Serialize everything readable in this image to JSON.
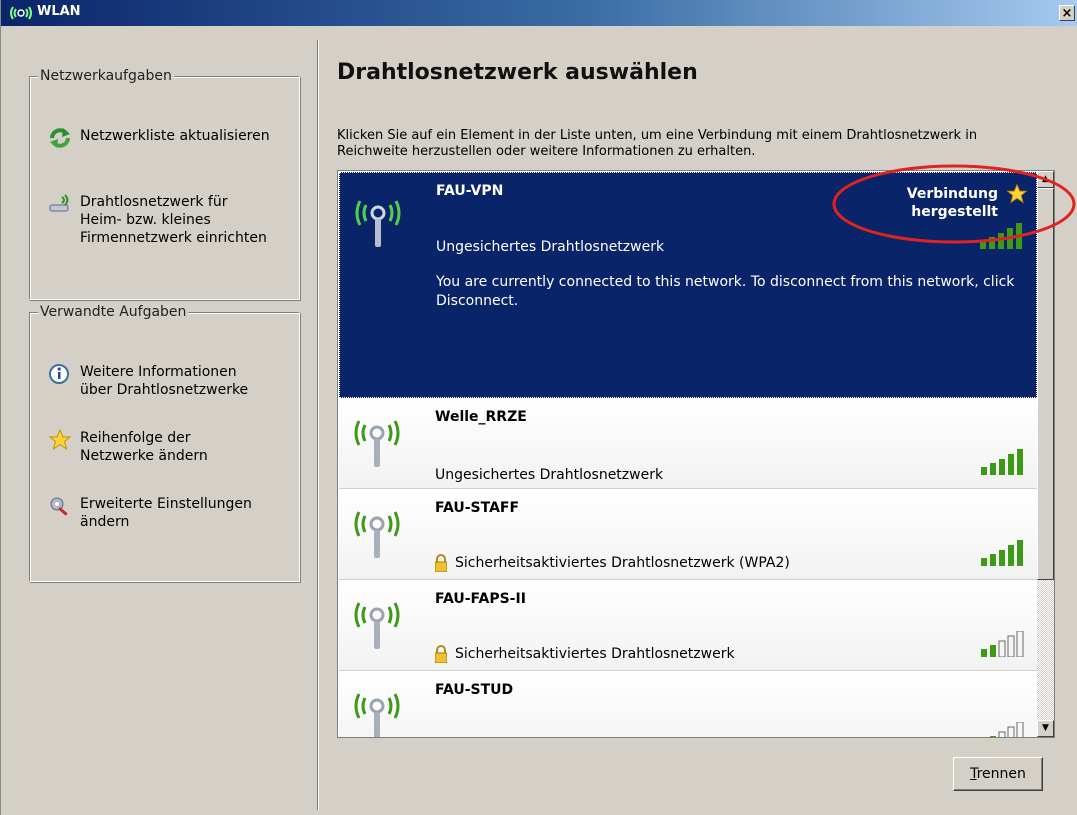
{
  "window": {
    "title": "WLAN",
    "close_label": "×"
  },
  "left_pane": {
    "network_tasks": {
      "legend": "Netzwerkaufgaben",
      "items": [
        {
          "label": "Netzwerkliste aktualisieren",
          "icon": "refresh-icon"
        },
        {
          "label": "Drahtlosnetzwerk für\nHeim- bzw. kleines\nFirmennetzwerk einrichten",
          "icon": "wireless-setup-icon"
        }
      ]
    },
    "related_tasks": {
      "legend": "Verwandte Aufgaben",
      "items": [
        {
          "label": "Weitere Informationen\nüber Drahtlosnetzwerke",
          "icon": "info-icon"
        },
        {
          "label": "Reihenfolge der\nNetzwerke ändern",
          "icon": "star-icon"
        },
        {
          "label": "Erweiterte Einstellungen\nändern",
          "icon": "settings-icon"
        }
      ]
    }
  },
  "main": {
    "heading": "Drahtlosnetzwerk auswählen",
    "instructions": "Klicken Sie auf ein Element in der Liste unten, um eine Verbindung mit einem Drahtlosnetzwerk in Reichweite herzustellen oder weitere Informationen zu erhalten.",
    "networks": [
      {
        "ssid": "FAU-VPN",
        "security": "Ungesichertes Drahtlosnetzwerk",
        "secured": false,
        "selected": true,
        "status": "Verbindung\nhergestellt",
        "description": "You are currently connected to this network. To disconnect from this network, click Disconnect.",
        "signal_bars": 5
      },
      {
        "ssid": "Welle_RRZE",
        "security": "Ungesichertes Drahtlosnetzwerk",
        "secured": false,
        "selected": false,
        "signal_bars": 5
      },
      {
        "ssid": "FAU-STAFF",
        "security": "Sicherheitsaktiviertes Drahtlosnetzwerk (WPA2)",
        "secured": true,
        "selected": false,
        "signal_bars": 5
      },
      {
        "ssid": "FAU-FAPS-II",
        "security": "Sicherheitsaktiviertes Drahtlosnetzwerk",
        "secured": true,
        "selected": false,
        "signal_bars": 2
      },
      {
        "ssid": "FAU-STUD",
        "security": "",
        "secured": false,
        "selected": false,
        "signal_bars": 2
      }
    ],
    "disconnect_button": {
      "underlined": "T",
      "rest": "rennen"
    }
  },
  "colors": {
    "titlebar": "#0a246a",
    "selected_row": "#0a246a",
    "signal_green": "#3d9a17",
    "highlight_ring": "#e0231f"
  }
}
